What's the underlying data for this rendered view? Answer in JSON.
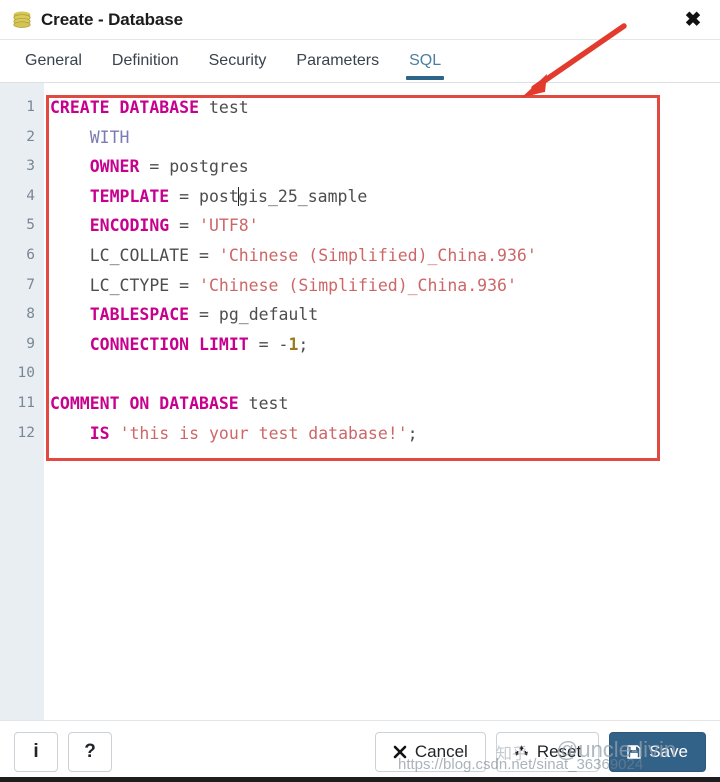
{
  "window": {
    "title": "Create - Database",
    "icon": "database-icon",
    "close_label": "✖"
  },
  "tabs": [
    {
      "label": "General",
      "active": false
    },
    {
      "label": "Definition",
      "active": false
    },
    {
      "label": "Security",
      "active": false
    },
    {
      "label": "Parameters",
      "active": false
    },
    {
      "label": "SQL",
      "active": true
    }
  ],
  "editor": {
    "line_numbers": [
      "1",
      "2",
      "3",
      "4",
      "5",
      "6",
      "7",
      "8",
      "9",
      "10",
      "11",
      "12"
    ],
    "lines": [
      {
        "n": 1,
        "tokens": [
          {
            "t": "CREATE DATABASE",
            "c": "kw"
          },
          {
            "t": " test",
            "c": "plain"
          }
        ]
      },
      {
        "n": 2,
        "tokens": [
          {
            "t": "    ",
            "c": "plain"
          },
          {
            "t": "WITH",
            "c": "kw2"
          }
        ]
      },
      {
        "n": 3,
        "tokens": [
          {
            "t": "    ",
            "c": "plain"
          },
          {
            "t": "OWNER",
            "c": "kw"
          },
          {
            "t": " = postgres",
            "c": "plain"
          }
        ]
      },
      {
        "n": 4,
        "tokens": [
          {
            "t": "    ",
            "c": "plain"
          },
          {
            "t": "TEMPLATE",
            "c": "kw"
          },
          {
            "t": " = post",
            "c": "plain"
          },
          {
            "t": "",
            "c": "caret"
          },
          {
            "t": "gis_25_sample",
            "c": "plain"
          }
        ]
      },
      {
        "n": 5,
        "tokens": [
          {
            "t": "    ",
            "c": "plain"
          },
          {
            "t": "ENCODING",
            "c": "kw"
          },
          {
            "t": " = ",
            "c": "plain"
          },
          {
            "t": "'UTF8'",
            "c": "str"
          }
        ]
      },
      {
        "n": 6,
        "tokens": [
          {
            "t": "    LC_COLLATE = ",
            "c": "plain"
          },
          {
            "t": "'Chinese (Simplified)_China.936'",
            "c": "str"
          }
        ]
      },
      {
        "n": 7,
        "tokens": [
          {
            "t": "    LC_CTYPE = ",
            "c": "plain"
          },
          {
            "t": "'Chinese (Simplified)_China.936'",
            "c": "str"
          }
        ]
      },
      {
        "n": 8,
        "tokens": [
          {
            "t": "    ",
            "c": "plain"
          },
          {
            "t": "TABLESPACE",
            "c": "kw"
          },
          {
            "t": " = pg_default",
            "c": "plain"
          }
        ]
      },
      {
        "n": 9,
        "tokens": [
          {
            "t": "    ",
            "c": "plain"
          },
          {
            "t": "CONNECTION LIMIT",
            "c": "kw"
          },
          {
            "t": " = -",
            "c": "plain"
          },
          {
            "t": "1",
            "c": "num"
          },
          {
            "t": ";",
            "c": "plain"
          }
        ]
      },
      {
        "n": 10,
        "tokens": [
          {
            "t": "",
            "c": "plain"
          }
        ]
      },
      {
        "n": 11,
        "tokens": [
          {
            "t": "COMMENT ON DATABASE",
            "c": "kw"
          },
          {
            "t": " test",
            "c": "plain"
          }
        ]
      },
      {
        "n": 12,
        "tokens": [
          {
            "t": "    ",
            "c": "plain"
          },
          {
            "t": "IS",
            "c": "kw"
          },
          {
            "t": " ",
            "c": "plain"
          },
          {
            "t": "'this is your test database!'",
            "c": "str"
          },
          {
            "t": ";",
            "c": "plain"
          }
        ]
      }
    ],
    "plain_text": "CREATE DATABASE test\n    WITH\n    OWNER = postgres\n    TEMPLATE = postgis_25_sample\n    ENCODING = 'UTF8'\n    LC_COLLATE = 'Chinese (Simplified)_China.936'\n    LC_CTYPE = 'Chinese (Simplified)_China.936'\n    TABLESPACE = pg_default\n    CONNECTION LIMIT = -1;\n\nCOMMENT ON DATABASE test\n    IS 'this is your test database!';"
  },
  "footer": {
    "info_label": "i",
    "help_label": "?",
    "cancel_label": "Cancel",
    "reset_label": "Reset",
    "save_label": "Save",
    "cancel_icon": "close-x-icon",
    "reset_icon": "recycle-refresh-icon",
    "save_icon": "floppy-save-icon"
  },
  "annotations": {
    "arrow_color": "#e23b2e",
    "box_color": "#e04a40"
  },
  "watermark": {
    "url": "https://blog.csdn.net/sinat_36369024",
    "handle": "@uncle-livin",
    "cn": "知乎"
  },
  "colors": {
    "accent": "#2d6489",
    "primary_button": "#336288",
    "keyword": "#c7008d",
    "string": "#cd6767",
    "number": "#9a7d22",
    "gutter_bg": "#e9eef3",
    "annotation_red": "#e04a40"
  }
}
